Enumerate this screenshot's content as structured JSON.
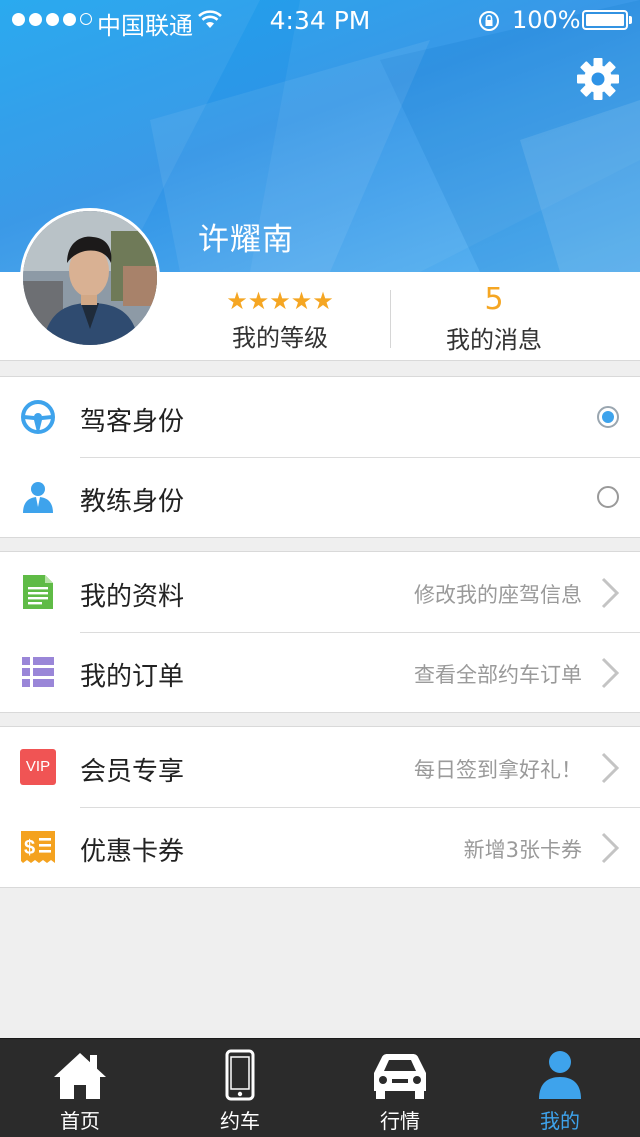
{
  "status_bar": {
    "carrier": "中国联通",
    "time": "4:34 PM",
    "battery": "100%"
  },
  "profile": {
    "username": "许耀南",
    "stars": "★★★★★",
    "level_label": "我的等级",
    "message_count": "5",
    "messages_label": "我的消息"
  },
  "identity": [
    {
      "label": "驾客身份",
      "icon": "steering-wheel-icon",
      "selected": true
    },
    {
      "label": "教练身份",
      "icon": "coach-person-icon",
      "selected": false
    }
  ],
  "account": [
    {
      "label": "我的资料",
      "hint": "修改我的座驾信息",
      "icon": "document-icon"
    },
    {
      "label": "我的订单",
      "hint": "查看全部约车订单",
      "icon": "list-icon"
    }
  ],
  "perks": [
    {
      "label": "会员专享",
      "hint": "每日签到拿好礼！",
      "icon": "vip-icon",
      "icon_text": "VIP"
    },
    {
      "label": "优惠卡券",
      "hint": "新增3张卡券",
      "icon": "coupon-icon"
    }
  ],
  "tabs": [
    {
      "label": "首页",
      "icon": "home-icon",
      "active": false
    },
    {
      "label": "约车",
      "icon": "phone-icon",
      "active": false
    },
    {
      "label": "行情",
      "icon": "car-icon",
      "active": false
    },
    {
      "label": "我的",
      "icon": "user-icon",
      "active": true
    }
  ],
  "colors": {
    "accent": "#3ea3ec",
    "star": "#f5a623",
    "header_blue": "#2f93e6",
    "tabbar": "#2b2b2b"
  }
}
